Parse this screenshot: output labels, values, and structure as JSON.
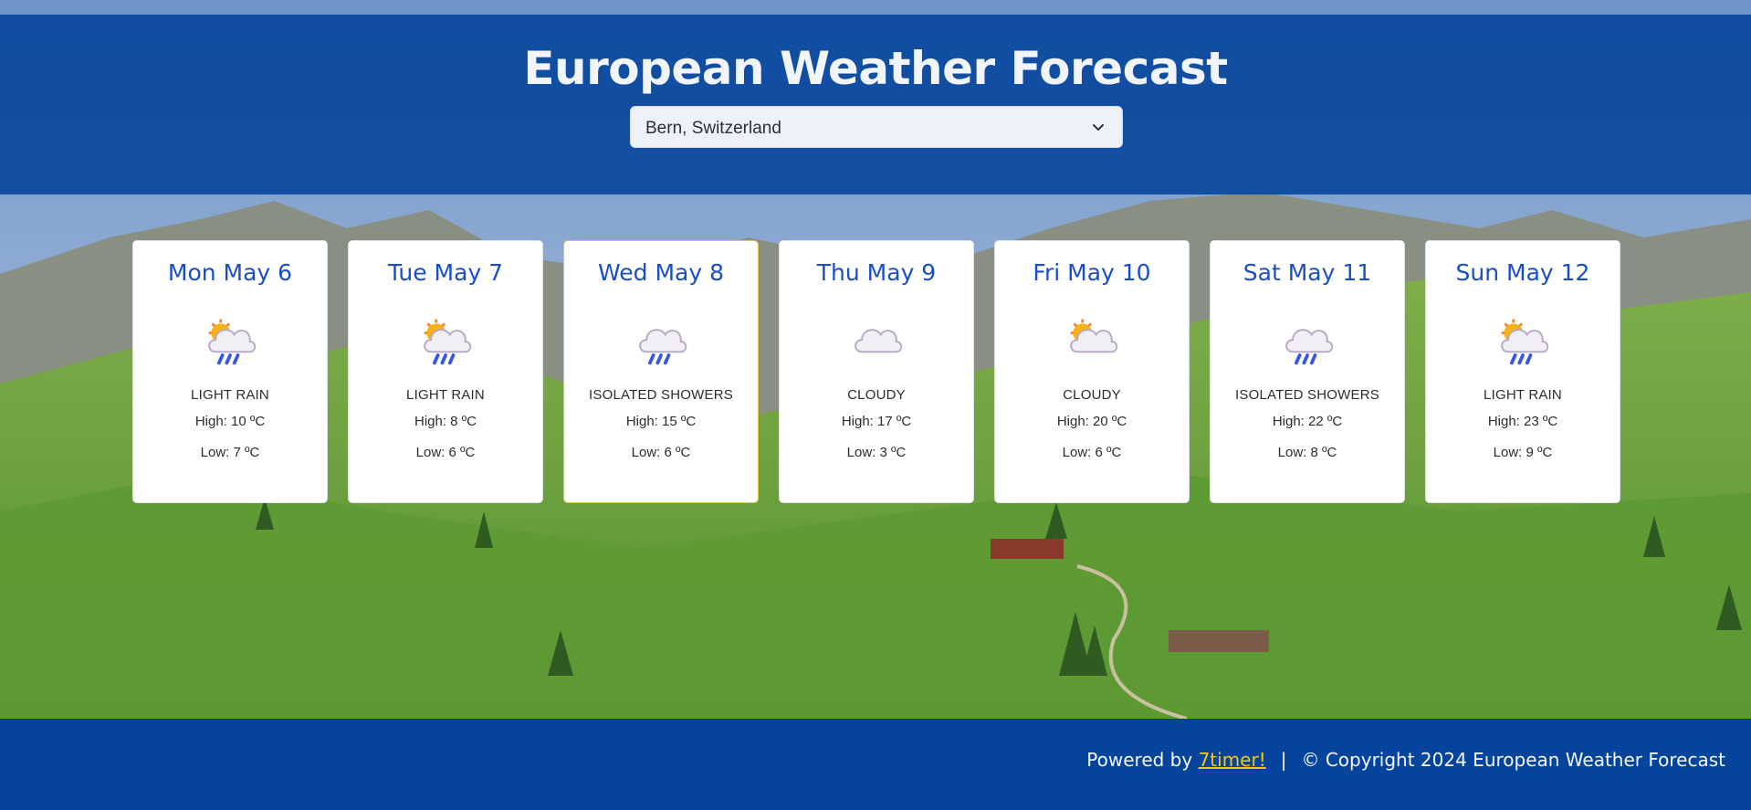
{
  "header": {
    "title": "European Weather Forecast",
    "location_select": {
      "value": "Bern, Switzerland"
    }
  },
  "forecast": [
    {
      "day": "Mon May 6",
      "icon": "light-rain-icon",
      "condition": "LIGHT RAIN",
      "high": "High: 10 ºC",
      "low": "Low: 7 ºC"
    },
    {
      "day": "Tue May 7",
      "icon": "light-rain-icon",
      "condition": "LIGHT RAIN",
      "high": "High: 8 ºC",
      "low": "Low: 6 ºC"
    },
    {
      "day": "Wed May 8",
      "icon": "isolated-showers-icon",
      "condition": "ISOLATED SHOWERS",
      "high": "High: 15 ºC",
      "low": "Low: 6 ºC"
    },
    {
      "day": "Thu May 9",
      "icon": "cloudy-icon",
      "condition": "CLOUDY",
      "high": "High: 17 ºC",
      "low": "Low: 3 ºC"
    },
    {
      "day": "Fri May 10",
      "icon": "partly-cloudy-icon",
      "condition": "CLOUDY",
      "high": "High: 20 ºC",
      "low": "Low: 6 ºC"
    },
    {
      "day": "Sat May 11",
      "icon": "isolated-showers-icon",
      "condition": "ISOLATED SHOWERS",
      "high": "High: 22 ºC",
      "low": "Low: 8 ºC"
    },
    {
      "day": "Sun May 12",
      "icon": "light-rain-icon",
      "condition": "LIGHT RAIN",
      "high": "High: 23 ºC",
      "low": "Low: 9 ºC"
    }
  ],
  "footer": {
    "powered_prefix": "Powered by",
    "powered_link": "7timer!",
    "separator": "|",
    "copyright": "© Copyright 2024 European Weather Forecast"
  },
  "colors": {
    "header_bg": "#00419b",
    "day_title": "#1a4ec7",
    "link": "#f5c518",
    "active_border": "#e3c44a"
  }
}
